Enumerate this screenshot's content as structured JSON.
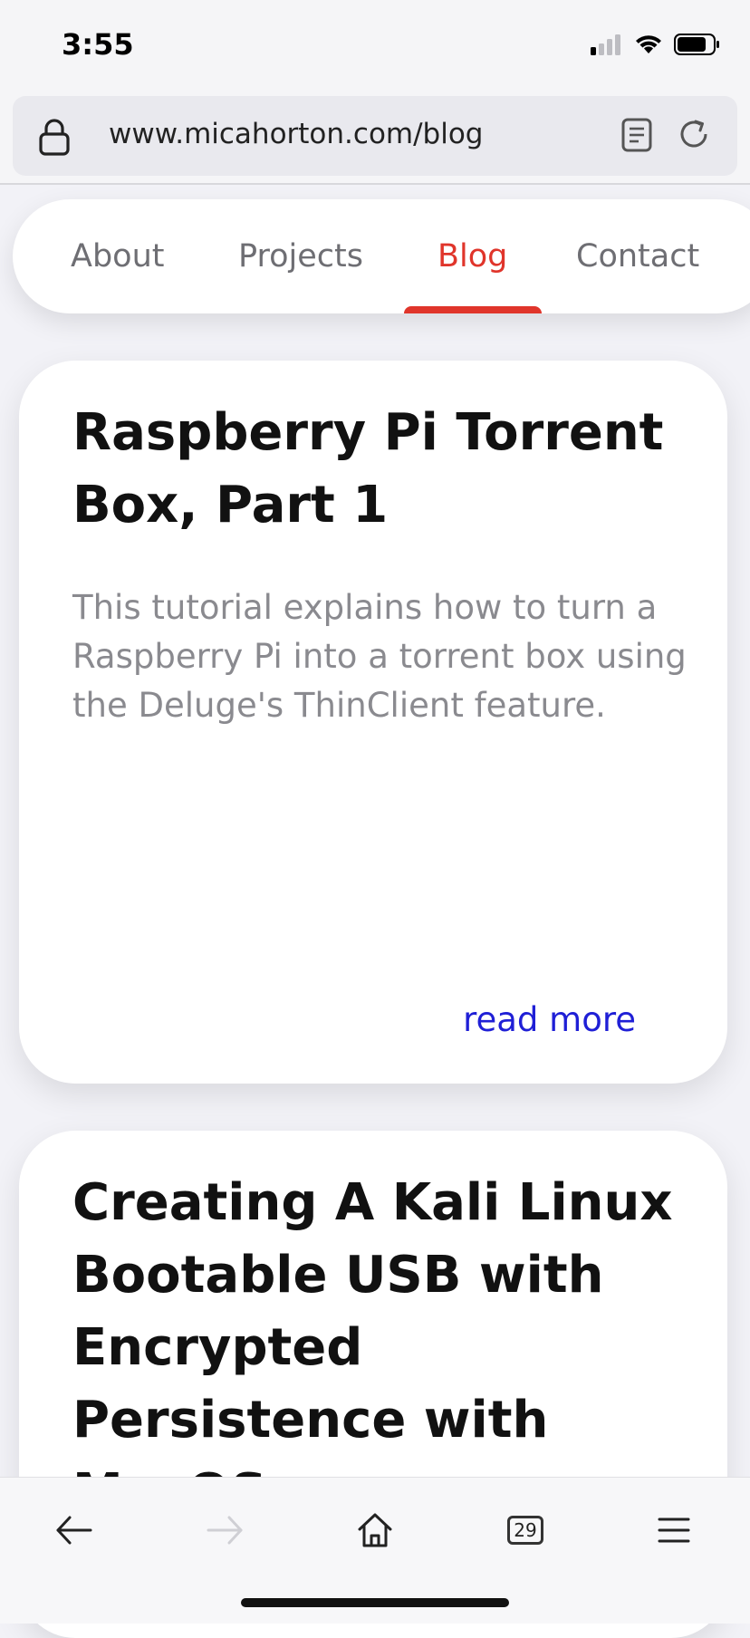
{
  "status_bar": {
    "time": "3:55",
    "icons": [
      "signal-icon",
      "wifi-icon",
      "battery-icon"
    ]
  },
  "browser": {
    "url": "www.micahorton.com/blog",
    "icons": [
      "lock-icon",
      "reader-mode-icon",
      "reload-icon"
    ]
  },
  "nav": {
    "items": [
      {
        "label": "About",
        "active": false
      },
      {
        "label": "Projects",
        "active": false
      },
      {
        "label": "Blog",
        "active": true
      },
      {
        "label": "Contact",
        "active": false
      }
    ],
    "active_color": "#e0352b"
  },
  "posts": [
    {
      "title": "Raspberry Pi Torrent Box, Part 1",
      "description": "This tutorial explains how to turn a Raspberry Pi into a torrent box using the Deluge's ThinClient feature.",
      "link_label": "read more"
    },
    {
      "title": "Creating A Kali Linux Bootable USB with Encrypted Persistence with MacOS"
    }
  ],
  "toolbar": {
    "tab_count": "29",
    "icons": [
      "back-arrow-icon",
      "forward-arrow-icon",
      "home-icon",
      "tabs-icon",
      "menu-icon"
    ]
  },
  "colors": {
    "accent": "#e0352b",
    "link": "#1f1fd6",
    "background": "#f2f2f7"
  }
}
